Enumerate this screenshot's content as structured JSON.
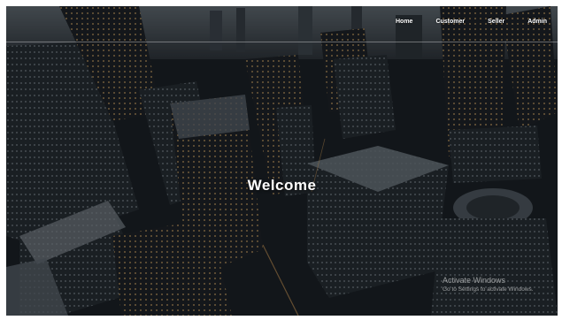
{
  "nav": {
    "items": [
      {
        "label": "Home"
      },
      {
        "label": "Customer"
      },
      {
        "label": "Seller"
      },
      {
        "label": "Admin"
      }
    ]
  },
  "hero": {
    "title": "Welcome"
  },
  "watermark": {
    "title": "Activate Windows",
    "subtitle": "Go to Settings to activate Windows."
  }
}
